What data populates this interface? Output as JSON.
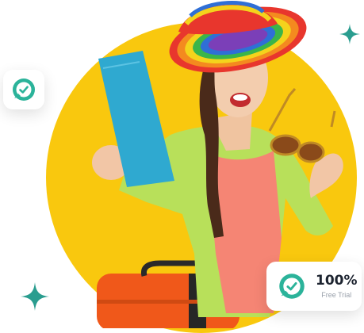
{
  "trial_badge": {
    "percent": "100%",
    "label": "Free Trial"
  },
  "colors": {
    "circle": "#f9c80e",
    "accent": "#2bb39a",
    "sparkle": "#2a9d8f"
  },
  "icons": [
    "sparkle-icon",
    "check-circle-icon"
  ]
}
